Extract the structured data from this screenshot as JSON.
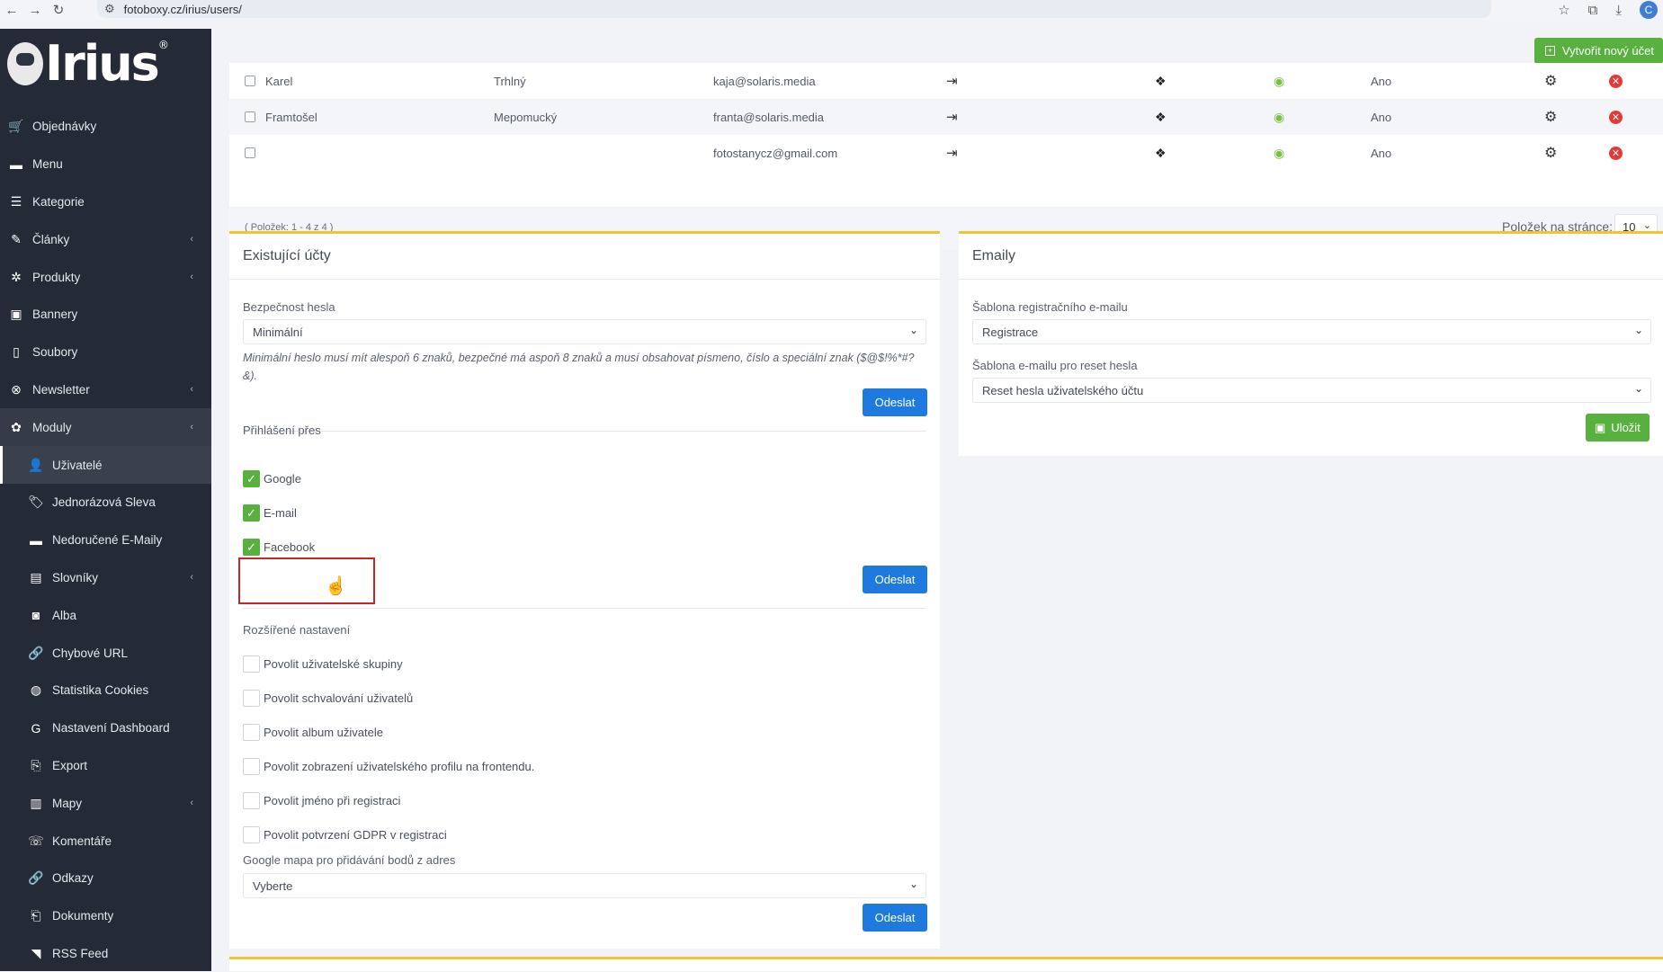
{
  "browser": {
    "url": "fotoboxy.cz/irius/users/",
    "back_icon": "←",
    "forward_icon": "→",
    "reload_icon": "↻",
    "tune_icon": "⚙",
    "star_icon": "☆",
    "download_icon": "⤓",
    "ext_icon": "⧉",
    "avatar": "C"
  },
  "logo": {
    "text": "Irius",
    "reg": "®"
  },
  "sidebar": {
    "items": [
      {
        "label": "Objednávky",
        "icon": "🛒"
      },
      {
        "label": "Menu",
        "icon": "▬"
      },
      {
        "label": "Kategorie",
        "icon": "☰"
      },
      {
        "label": "Články",
        "icon": "✎",
        "chevron": "‹"
      },
      {
        "label": "Produkty",
        "icon": "✲",
        "chevron": "‹"
      },
      {
        "label": "Bannery",
        "icon": "▣"
      },
      {
        "label": "Soubory",
        "icon": "▯"
      },
      {
        "label": "Newsletter",
        "icon": "⊗",
        "chevron": "‹"
      },
      {
        "label": "Moduly",
        "icon": "✿",
        "chevron": "‹"
      },
      {
        "label": "Uživatelé",
        "icon": "👤"
      },
      {
        "label": "Jednorázová Sleva",
        "icon": "🏷"
      },
      {
        "label": "Nedoručené E-Maily",
        "icon": "▬"
      },
      {
        "label": "Slovníky",
        "icon": "▤",
        "chevron": "‹"
      },
      {
        "label": "Alba",
        "icon": "◙"
      },
      {
        "label": "Chybové URL",
        "icon": "🔗"
      },
      {
        "label": "Statistika Cookies",
        "icon": "◍"
      },
      {
        "label": "Nastavení Dashboard",
        "icon": "G"
      },
      {
        "label": "Export",
        "icon": "⎘"
      },
      {
        "label": "Mapy",
        "icon": "▥",
        "chevron": "‹"
      },
      {
        "label": "Komentáře",
        "icon": "☏"
      },
      {
        "label": "Odkazy",
        "icon": "🔗"
      },
      {
        "label": "Dokumenty",
        "icon": "⎗"
      },
      {
        "label": "RSS Feed",
        "icon": "◥"
      }
    ]
  },
  "header": {
    "create_button": "Vytvořit nový účet"
  },
  "users": {
    "rows": [
      {
        "first": "Karel",
        "last": "Trhlný",
        "email": "kaja@solaris.media",
        "active": "Ano"
      },
      {
        "first": "Framtošel",
        "last": "Mepomucký",
        "email": "franta@solaris.media",
        "active": "Ano"
      },
      {
        "first": "",
        "last": "",
        "email": "fotostanycz@gmail.com",
        "active": "Ano"
      }
    ],
    "icons": {
      "login": "⇥",
      "dropbox": "❖",
      "view": "◉",
      "settings": "⚙",
      "delete": "✕"
    },
    "pager_info": "( Položek: 1 - 4 z 4 )",
    "per_page_label": "Položek na stránce:",
    "per_page_value": "10"
  },
  "accounts_panel": {
    "title": "Existující účty",
    "password_label": "Bezpečnost hesla",
    "password_value": "Minimální",
    "password_hint": "Minimální heslo musí mít alespoň 6 znaků, bezpečné má aspoň 8 znaků a musí obsahovat písmeno, číslo a speciální znak ($@$!%*#?&).",
    "submit": "Odeslat",
    "login_via_label": "Přihlášení přes",
    "login_options": [
      {
        "label": "Google",
        "checked": true
      },
      {
        "label": "E-mail",
        "checked": true
      },
      {
        "label": "Facebook",
        "checked": true
      }
    ],
    "advanced_label": "Rozšířené nastavení",
    "advanced_options": [
      {
        "label": "Povolit uživatelské skupiny",
        "checked": false
      },
      {
        "label": "Povolit schvalování uživatelů",
        "checked": false
      },
      {
        "label": "Povolit album uživatele",
        "checked": false
      },
      {
        "label": "Povolit zobrazení uživatelského profilu na frontendu.",
        "checked": false
      },
      {
        "label": "Povolit jméno při registraci",
        "checked": false
      },
      {
        "label": "Povolit potvrzení GDPR v registraci",
        "checked": false
      }
    ],
    "map_label": "Google mapa pro přidávání bodů z adres",
    "map_value": "Vyberte"
  },
  "emails_panel": {
    "title": "Emaily",
    "reg_label": "Šablona registračního e-mailu",
    "reg_value": "Registrace",
    "reset_label": "Šablona e-mailu pro reset hesla",
    "reset_value": "Reset hesla uživatelského účtu",
    "save": "Uložit"
  },
  "colors": {
    "sidebar": "#252b36",
    "accent": "#f4c430",
    "primary": "#1f7ae0",
    "success": "#58b13e",
    "danger": "#e53935"
  }
}
